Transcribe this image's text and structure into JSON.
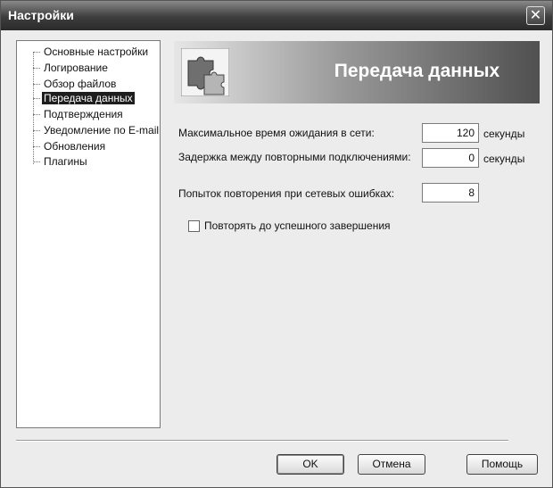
{
  "window": {
    "title": "Настройки"
  },
  "tree": {
    "items": [
      {
        "label": "Основные настройки"
      },
      {
        "label": "Логирование"
      },
      {
        "label": "Обзор файлов"
      },
      {
        "label": "Передача данных"
      },
      {
        "label": "Подтверждения"
      },
      {
        "label": "Уведомление по E-mail"
      },
      {
        "label": "Обновления"
      },
      {
        "label": "Плагины"
      }
    ],
    "selected": "Передача данных"
  },
  "banner": {
    "title": "Передача данных",
    "icon": "puzzle-icon"
  },
  "settings": {
    "timeout": {
      "label": "Максимальное время ожидания в сети:",
      "value": "120",
      "unit": "секунды"
    },
    "reconnect_delay": {
      "label": "Задержка между повторными подключениями:",
      "value": "0",
      "unit": "секунды"
    },
    "retries": {
      "label": "Попыток повторения при сетевых ошибках:",
      "value": "8"
    },
    "repeat_until_success": {
      "label": "Повторять до успешного завершения",
      "checked": false
    }
  },
  "buttons": {
    "ok": "OK",
    "cancel": "Отмена",
    "help": "Помощь"
  }
}
